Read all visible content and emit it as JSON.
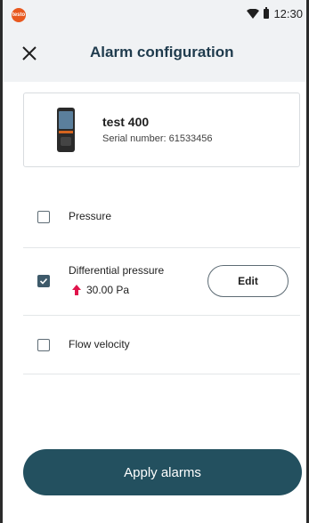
{
  "status": {
    "logo_text": "testo",
    "time": "12:30"
  },
  "header": {
    "title": "Alarm configuration"
  },
  "device": {
    "name": "test 400",
    "serial": "Serial number: 61533456"
  },
  "options": [
    {
      "label": "Pressure",
      "checked": false
    },
    {
      "label": "Differential pressure",
      "checked": true,
      "value": "30.00 Pa",
      "edit_label": "Edit"
    },
    {
      "label": "Flow velocity",
      "checked": false
    }
  ],
  "apply_label": "Apply alarms",
  "colors": {
    "accent": "#23505f",
    "alarm_arrow": "#e0144b",
    "logo": "#e8581e"
  }
}
